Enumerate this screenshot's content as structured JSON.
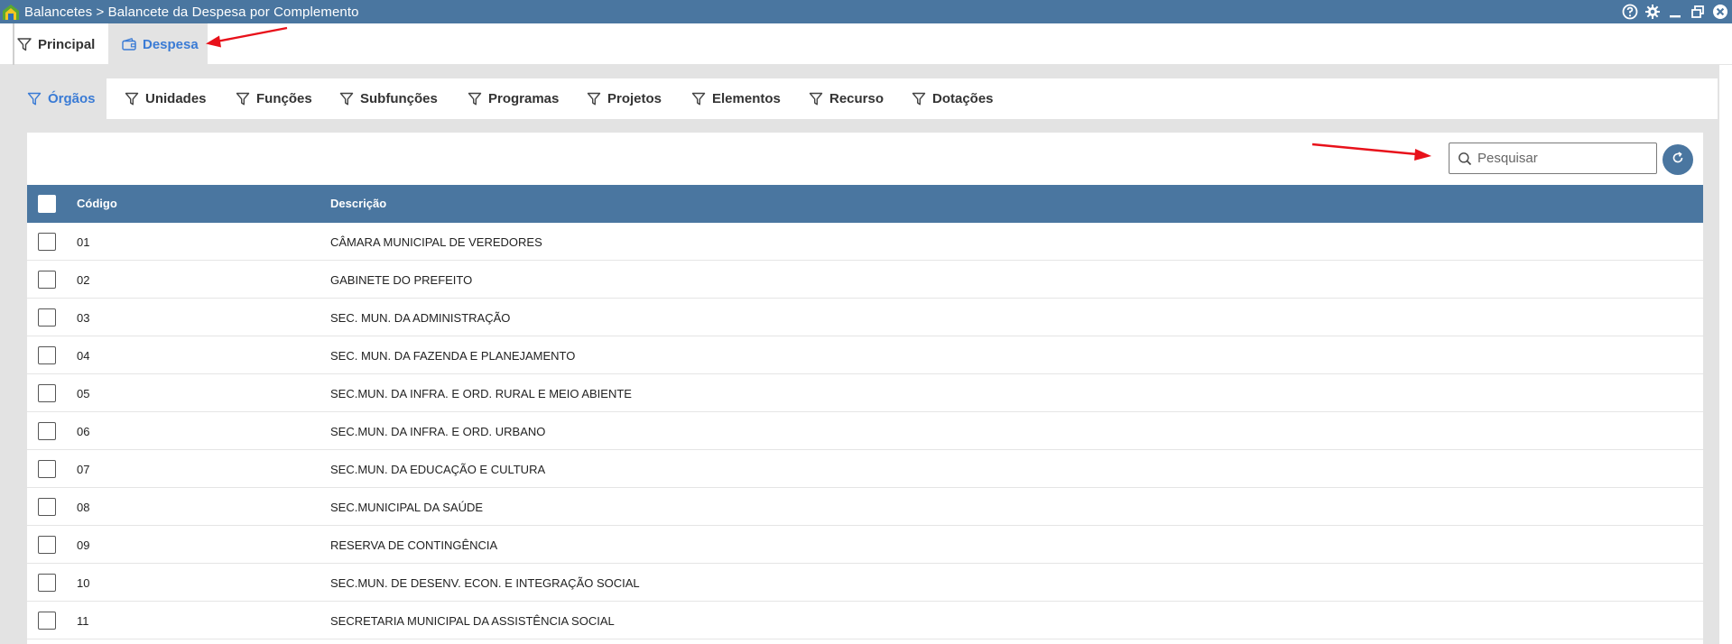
{
  "window": {
    "title": "Balancetes > Balancete da Despesa por Complemento"
  },
  "main_tabs": [
    {
      "label": "Principal",
      "icon": "filter-icon"
    },
    {
      "label": "Despesa",
      "icon": "wallet-icon"
    }
  ],
  "sub_tabs": [
    {
      "label": "Órgãos"
    },
    {
      "label": "Unidades"
    },
    {
      "label": "Funções"
    },
    {
      "label": "Subfunções"
    },
    {
      "label": "Programas"
    },
    {
      "label": "Projetos"
    },
    {
      "label": "Elementos"
    },
    {
      "label": "Recurso"
    },
    {
      "label": "Dotações"
    }
  ],
  "search": {
    "placeholder": "Pesquisar"
  },
  "table": {
    "headers": {
      "code": "Código",
      "description": "Descrição"
    },
    "rows": [
      {
        "code": "01",
        "description": "CÂMARA MUNICIPAL DE VEREDORES"
      },
      {
        "code": "02",
        "description": "GABINETE DO PREFEITO"
      },
      {
        "code": "03",
        "description": "SEC. MUN. DA ADMINISTRAÇÃO"
      },
      {
        "code": "04",
        "description": "SEC. MUN. DA FAZENDA E PLANEJAMENTO"
      },
      {
        "code": "05",
        "description": "SEC.MUN. DA INFRA. E ORD. RURAL E MEIO ABIENTE"
      },
      {
        "code": "06",
        "description": "SEC.MUN. DA INFRA. E ORD. URBANO"
      },
      {
        "code": "07",
        "description": "SEC.MUN. DA EDUCAÇÃO E CULTURA"
      },
      {
        "code": "08",
        "description": "SEC.MUNICIPAL DA SAÚDE"
      },
      {
        "code": "09",
        "description": "RESERVA DE CONTINGÊNCIA"
      },
      {
        "code": "10",
        "description": "SEC.MUN. DE DESENV. ECON. E INTEGRAÇÃO SOCIAL"
      },
      {
        "code": "11",
        "description": "SECRETARIA MUNICIPAL DA ASSISTÊNCIA SOCIAL"
      }
    ]
  },
  "colors": {
    "header_blue": "#4a76a0",
    "active_blue": "#3a7bd5",
    "annotation_red": "#e8111a",
    "background_gray": "#e3e3e3"
  }
}
